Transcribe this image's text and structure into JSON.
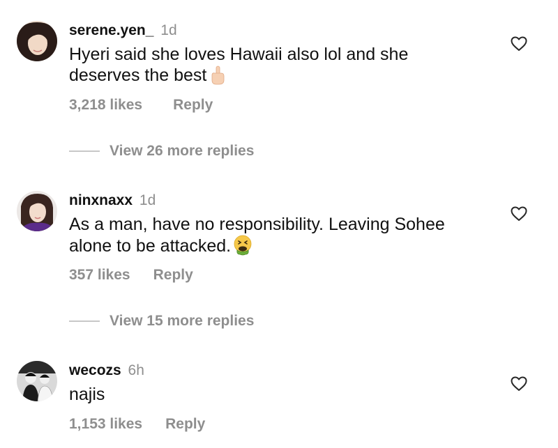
{
  "comments": [
    {
      "username": "serene.yen_",
      "time": "1d",
      "text_line1": "Hyeri said she loves Hawaii also lol and she",
      "text_line2": "deserves the best",
      "emoji": "middle-finger-emoji",
      "likes": "3,218 likes",
      "reply": "Reply",
      "more_replies": "View 26 more replies"
    },
    {
      "username": "ninxnaxx",
      "time": "1d",
      "text_line1": "As a man, have no responsibility. Leaving Sohee",
      "text_line2": "alone to be attacked.",
      "emoji": "vomiting-face-emoji",
      "likes": "357 likes",
      "reply": "Reply",
      "more_replies": "View 15 more replies"
    },
    {
      "username": "wecozs",
      "time": "6h",
      "text_line1": "najis",
      "likes": "1,153 likes",
      "reply": "Reply"
    }
  ],
  "icons": {
    "like": "heart-outline-icon"
  },
  "colors": {
    "primary_text": "#111111",
    "secondary_text": "#8e8e8e",
    "divider": "#c7c7c7"
  }
}
